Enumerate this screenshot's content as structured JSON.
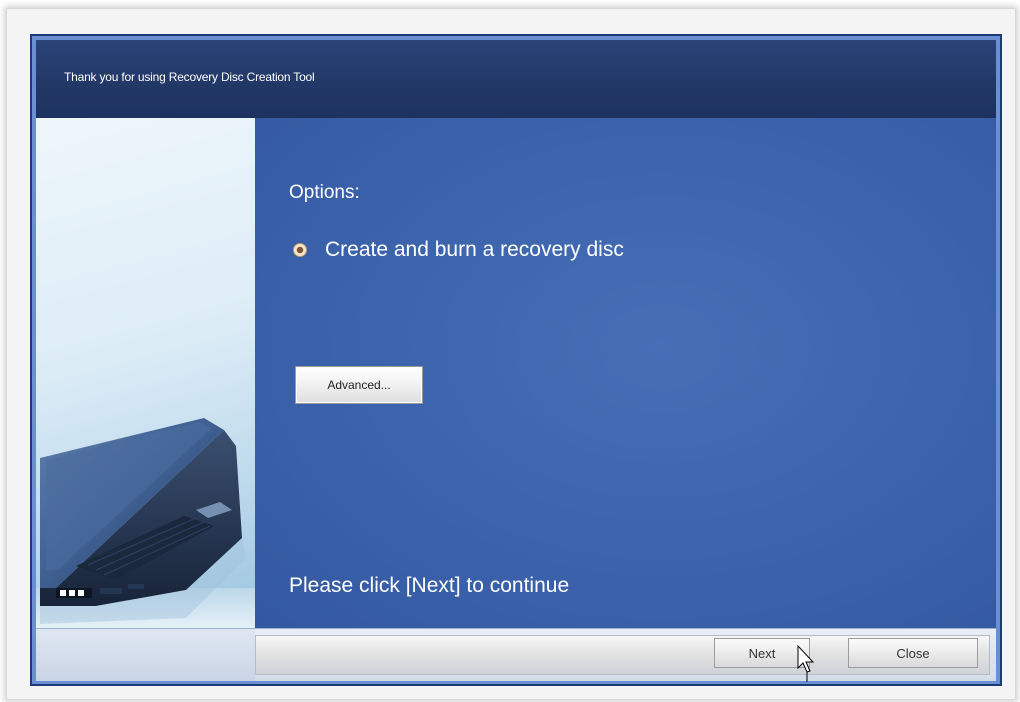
{
  "window": {
    "title": "Thank you for using Recovery Disc Creation Tool"
  },
  "content": {
    "options_title": "Options:",
    "radio_option": {
      "label": "Create and burn a recovery disc",
      "selected": true
    },
    "advanced_button_label": "Advanced...",
    "continue_text": "Please click [Next] to continue"
  },
  "footer": {
    "next_label": "Next",
    "close_label": "Close"
  },
  "colors": {
    "header": "#213766",
    "content_bg": "#3c64ad",
    "text": "#ffffff"
  },
  "icons": {
    "side_image": "laptop-illustration",
    "pointer": "mouse-pointer-icon"
  }
}
